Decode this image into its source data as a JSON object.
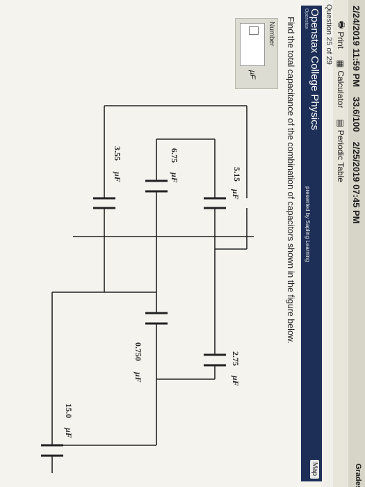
{
  "topbar": {
    "date1": "2/24/2019 11:59 PM",
    "score": "33.6/100",
    "date2": "2/25/2019 07:45 PM",
    "grades": "Grades"
  },
  "toolbar": {
    "print": "Print",
    "calculator": "Calculator",
    "periodic": "Periodic Table"
  },
  "question_counter": "Question 25 of 29",
  "header": {
    "title": "Openstax College Physics",
    "subtitle": "Openstax",
    "presented": "presented by Sapling Learning",
    "map": "Map"
  },
  "question_text": "Find the total capacitance of the combination of capacitors shown in the figure below.",
  "answer": {
    "label": "Number",
    "unit": "μF"
  },
  "circuit": {
    "c1": "5.15",
    "c2": "2.75",
    "c3": "6.75",
    "c4": "3.55",
    "c5": "0.750",
    "c6": "15.0",
    "unit": "μF"
  },
  "colors": {
    "header_bg": "#1d2f57",
    "page_bg": "#f4f3ee",
    "wire": "#222222"
  }
}
